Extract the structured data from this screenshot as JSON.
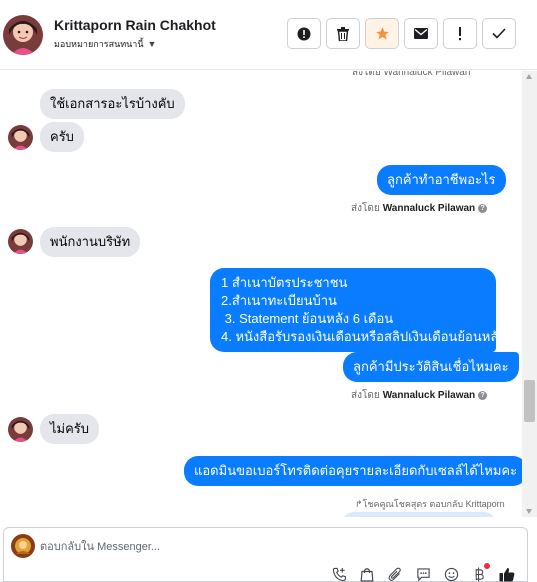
{
  "header": {
    "contact_name": "Krittaporn Rain Chakhot",
    "assign_label": "มอบหมายการสนทนานี้",
    "actions": [
      {
        "icon": "alert-circle-icon",
        "name": "spam-button"
      },
      {
        "icon": "trash-icon",
        "name": "delete-button"
      },
      {
        "icon": "star-icon",
        "name": "star-button"
      },
      {
        "icon": "envelope-icon",
        "name": "mark-unread-button"
      },
      {
        "icon": "exclamation-icon",
        "name": "follow-up-button"
      },
      {
        "icon": "check-icon",
        "name": "mark-done-button"
      }
    ],
    "accent_star": "#f7923a"
  },
  "chat": {
    "top_partial_sender": "ส่งโดย Wannaluck Pilawan",
    "messages": {
      "m1": "ใช้เอกสารอะไรบ้างคับ",
      "m2": "ครับ",
      "m3": "ลูกค้าทำอาชีพอะไร",
      "sent_by_prefix": "ส่งโดย",
      "sent_by_name": "Wannaluck Pilawan",
      "m4": "พนักงานบริษัท",
      "m5_lines": [
        "1 สำเนาบัตรประชาชน",
        "2.สำเนาทะเบียนบ้าน",
        " 3. Statement ย้อนหลัง 6 เดือน",
        "4. หนังสือรับรองเงินเดือนหรือสลิปเงินเดือนย้อนหลัง"
      ],
      "m6": "ลูกค้ามีประวัติสินเชื่อไหมคะ",
      "m7": "ไม่ครับ",
      "m8": "แอดมินขอเบอร์โทรติดต่อคุยรายละเอียดกับเซลล์ได้ไหมคะ",
      "reply_note": "↱โชคคูณโชคสุดร ตอบกลับ Krittaporn"
    },
    "outgoing_color": "#0a7cff",
    "incoming_color": "#e4e6eb"
  },
  "composer": {
    "placeholder": "ตอบกลับใน Messenger...",
    "tools": [
      "add-call-icon",
      "shopping-bag-icon",
      "attachment-icon",
      "saved-replies-icon",
      "emoji-icon",
      "currency-icon",
      "like-icon"
    ]
  }
}
